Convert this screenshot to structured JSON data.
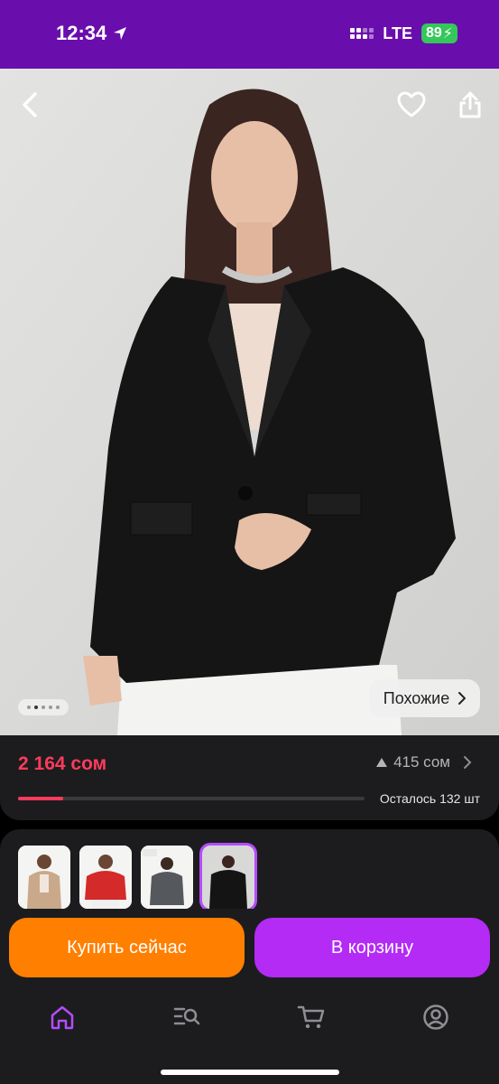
{
  "status_bar": {
    "time": "12:34",
    "network": "LTE",
    "battery": "89"
  },
  "hero": {
    "icons": [
      "back-arrow-icon",
      "heart-icon",
      "share-icon"
    ],
    "carousel_total": 5,
    "carousel_active": 2,
    "similar_label": "Похожие"
  },
  "price": {
    "current": "2 164 сом",
    "change": "415 сом",
    "stock_label": "Осталось 132 шт",
    "progress": 0.13,
    "accent": "#ff3b5c"
  },
  "thumbnails": [
    {
      "color": "beige",
      "selected": false
    },
    {
      "color": "red",
      "selected": false
    },
    {
      "color": "gray",
      "selected": false
    },
    {
      "color": "black",
      "selected": true
    }
  ],
  "actions": {
    "buy_now": "Купить сейчас",
    "add_to_cart": "В корзину",
    "buy_color": "#ff7f00",
    "cart_color": "#b32bf5"
  },
  "tabbar": {
    "items": [
      "home-icon",
      "catalog-search-icon",
      "cart-icon",
      "profile-icon"
    ],
    "active": "home-icon"
  }
}
